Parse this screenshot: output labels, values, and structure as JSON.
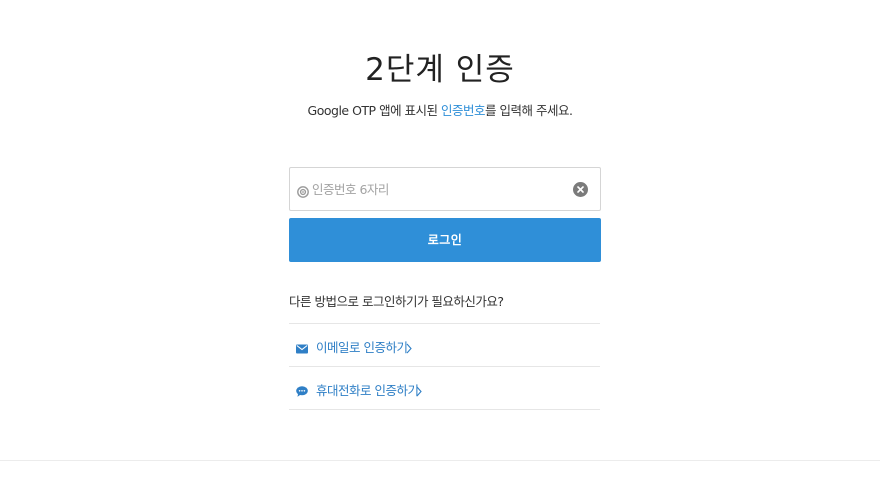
{
  "page": {
    "title": "2단계 인증",
    "desc_prefix": "Google OTP 앱에 표시된 ",
    "desc_highlight": "인증번호",
    "desc_suffix": "를 입력해 주세요."
  },
  "otp": {
    "value": "",
    "placeholder": "인증번호 6자리"
  },
  "login_button": "로그인",
  "alternatives": {
    "question": "다른 방법으로 로그인하기가 필요하신가요?",
    "items": [
      {
        "label": "이메일로 인증하기",
        "icon": "envelope-icon"
      },
      {
        "label": "휴대전화로 인증하기",
        "icon": "chat-bubble-icon"
      }
    ]
  },
  "colors": {
    "accent": "#2f8fd8",
    "link": "#2f7fc6"
  }
}
